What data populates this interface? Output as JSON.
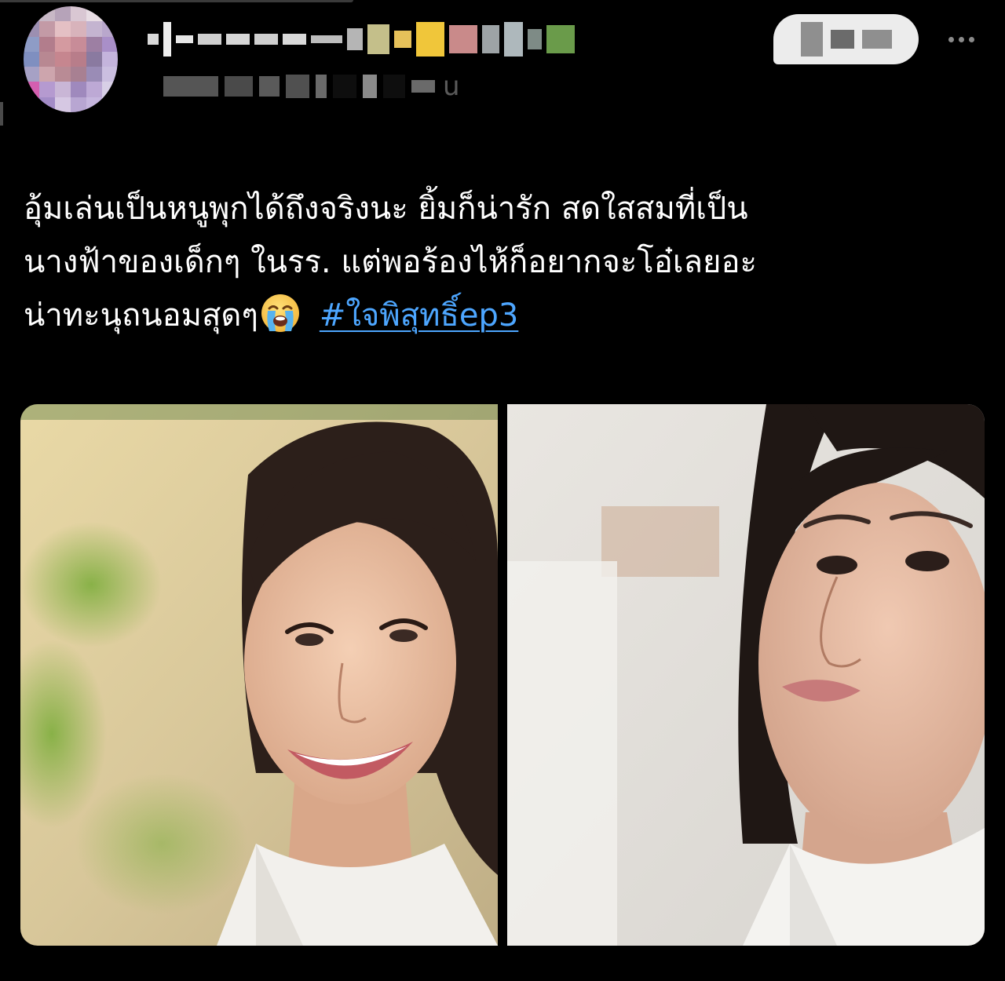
{
  "tweet": {
    "text_lines": [
      "อุ้มเล่นเป็นหนูพุกได้ถึงจริงนะ ยิ้มก็น่ารัก สดใสสมที่เป็น",
      "นางฟ้าของเด็กๆ ในรร. แต่พอร้องไห้ก็อยากจะโอ๋เลยอะ",
      "น่าทะนุถนอมสุดๆ"
    ],
    "emoji": "crying-face-emoji",
    "hashtag": "#ใจพิสุทธิ์ep3"
  },
  "header": {
    "handle_suffix": "u",
    "avatar_icon": "avatar-pixelated",
    "more_icon": "more-dots-icon"
  },
  "colors": {
    "background": "#000000",
    "text": "#ffffff",
    "hashtag": "#4da6ff",
    "follow_button_bg": "#ececec",
    "muted": "#8a8a8a"
  }
}
